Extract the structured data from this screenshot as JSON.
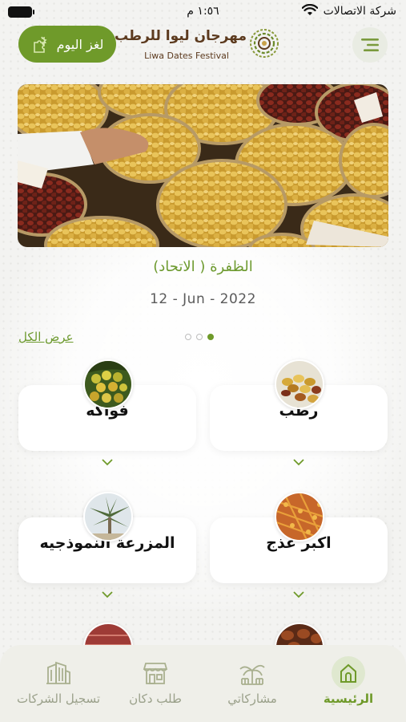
{
  "status_bar": {
    "carrier": "شركة الاتصالات",
    "time": "١:٥٦ م"
  },
  "header": {
    "puzzle_button_label": "لغز اليوم",
    "logo_title_ar": "مهرجان ليوا للرطب",
    "logo_title_en": "Liwa Dates Festival"
  },
  "banner": {
    "caption": "الظفرة ( الاتحاد)",
    "date": "12 - Jun - 2022",
    "slide_count": 3,
    "active_slide": 3
  },
  "categories_header": {
    "view_all_label": "عرض الكل"
  },
  "categories": [
    {
      "label": "رطب",
      "icon": "fresh-dates-image"
    },
    {
      "label": "فواكه",
      "icon": "fruits-image"
    },
    {
      "label": "اكبر عذج",
      "icon": "date-cluster-image"
    },
    {
      "label": "المزرعة النموذجيه",
      "icon": "model-farm-image"
    }
  ],
  "bottom_nav": {
    "items": [
      {
        "label": "الرئيسية",
        "icon": "home-icon",
        "active": true
      },
      {
        "label": "مشاركاتي",
        "icon": "palm-tree-icon",
        "active": false
      },
      {
        "label": "طلب دكان",
        "icon": "shop-icon",
        "active": false
      },
      {
        "label": "تسجيل الشركات",
        "icon": "buildings-icon",
        "active": false
      }
    ]
  },
  "colors": {
    "accent_green": "#6f9a2a",
    "brand_brown": "#5c3a1e",
    "nav_inactive": "#9aa08a"
  }
}
